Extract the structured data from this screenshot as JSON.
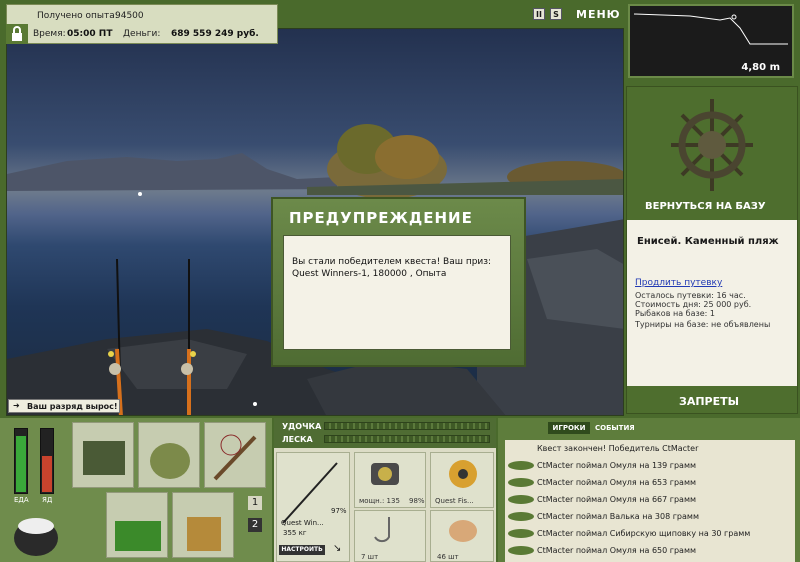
{
  "hud": {
    "xp_label": "Получено опыта:",
    "xp_value": "94500",
    "time_label": "Время:",
    "time_value": "05:00 ПТ",
    "money_label": "Деньги:",
    "money_value": "689 559 249 руб.",
    "menu_label": "МЕНЮ",
    "help_label": "S",
    "pause_label": "II"
  },
  "depth": {
    "value": "4,80 m"
  },
  "base": {
    "return_label": "ВЕРНУТЬСЯ НА БАЗУ",
    "location_title": "Енисей. Каменный пляж",
    "extend_link": "Продлить путевку",
    "pass_left": "Осталось путевки: 16 час.",
    "day_cost": "Стоимость дня: 25 000 руб.",
    "fishers": "Рыбаков на базе: 1",
    "tournaments": "Турниры на базе: не объявлены",
    "bans_label": "ЗАПРЕТЫ"
  },
  "dialog": {
    "title": "ПРЕДУПРЕЖДЕНИЕ",
    "message": "Вы стали победителем квеста! Ваш приз: Quest Winners-1, 180000 , Опыта"
  },
  "notice": {
    "text": "Ваш разряд вырос!"
  },
  "needs": {
    "food_label": "ЕДА",
    "poison_label": "ЯД",
    "food_level": 0.85,
    "poison_level": 0.55
  },
  "tackle": {
    "rod_label": "УДОЧКА",
    "line_label": "ЛЕСКА",
    "rod_name": "Quest Win...",
    "rod_weight": "355 кг",
    "rod_percent": "97%",
    "setup_button": "НАСТРОИТЬ",
    "reel_name": "мощн.: 135",
    "reel_percent": "98%",
    "line_name": "Quest Fis...",
    "hook_count": "7 шт",
    "bait_count": "46 шт"
  },
  "inventory": {
    "page_1": "1",
    "page_2": "2"
  },
  "chat": {
    "tab_players": "ИГРОКИ",
    "tab_events": "СОБЫТИЯ",
    "header": "Квест закончен! Победитель CtMacter",
    "events": [
      "CtMacter поймал Омуля на 139 грамм",
      "CtMacter поймал Омуля на 653 грамм",
      "CtMacter поймал Омуля на 667 грамм",
      "CtMacter поймал Валька на 308 грамм",
      "CtMacter поймал Сибирскую щиповку на 30 грамм",
      "CtMacter поймал Омуля на 650 грамм"
    ]
  }
}
